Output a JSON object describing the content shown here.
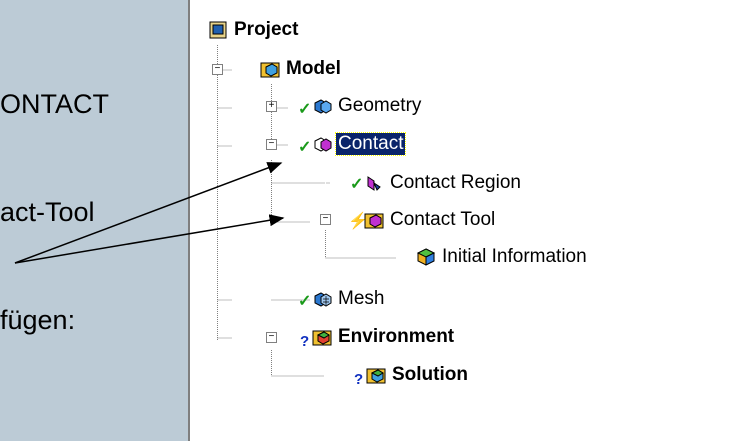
{
  "slide": {
    "line1": "ONTACT",
    "line2": "act-Tool",
    "line3": "fügen:"
  },
  "tree": {
    "project": {
      "label": "Project",
      "icon": "project-icon"
    },
    "model": {
      "label": "Model",
      "icon": "model-icon",
      "expanded": true
    },
    "geometry": {
      "label": "Geometry",
      "icon": "geometry-icon",
      "status": "check",
      "expanded": false
    },
    "contact": {
      "label": "Contact",
      "icon": "contact-icon",
      "status": "check",
      "expanded": true,
      "selected": true
    },
    "contact_region": {
      "label": "Contact Region",
      "icon": "contact-region-icon",
      "status": "check"
    },
    "contact_tool": {
      "label": "Contact Tool",
      "icon": "contact-tool-icon",
      "status": "lightning",
      "expanded": true
    },
    "initial_information": {
      "label": "Initial Information",
      "icon": "initial-information-icon"
    },
    "mesh": {
      "label": "Mesh",
      "icon": "mesh-icon",
      "status": "check"
    },
    "environment": {
      "label": "Environment",
      "icon": "environment-icon",
      "status": "question",
      "expanded": true
    },
    "solution": {
      "label": "Solution",
      "icon": "solution-icon",
      "status": "question"
    }
  },
  "colors": {
    "slide_background": "#bccbd6",
    "selection": "#0a246a",
    "check": "#1a9a1a",
    "question": "#1030c0",
    "lightning": "#e8c000"
  }
}
